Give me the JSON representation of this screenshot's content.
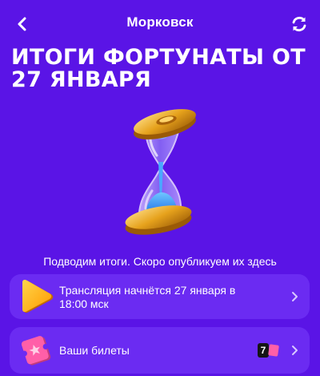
{
  "header": {
    "title": "Морковск",
    "back_icon": "chevron-left-icon",
    "refresh_icon": "refresh-icon"
  },
  "main": {
    "headline": "Итоги Фортунаты от 27 января",
    "illustration": "hourglass-icon",
    "status": "Подводим итоги. Скоро опубликуем их здесь"
  },
  "cards": {
    "stream": {
      "icon": "play-icon",
      "text": "Трансляция начнётся 27 января в 18:00 мск"
    },
    "tickets": {
      "icon": "ticket-icon",
      "label": "Ваши билеты",
      "count": "7"
    }
  },
  "colors": {
    "background": "#5a14e6",
    "card": "#6b2bf2",
    "accent_play": "#ffb400",
    "ticket_pink": "#ff5fa8"
  }
}
